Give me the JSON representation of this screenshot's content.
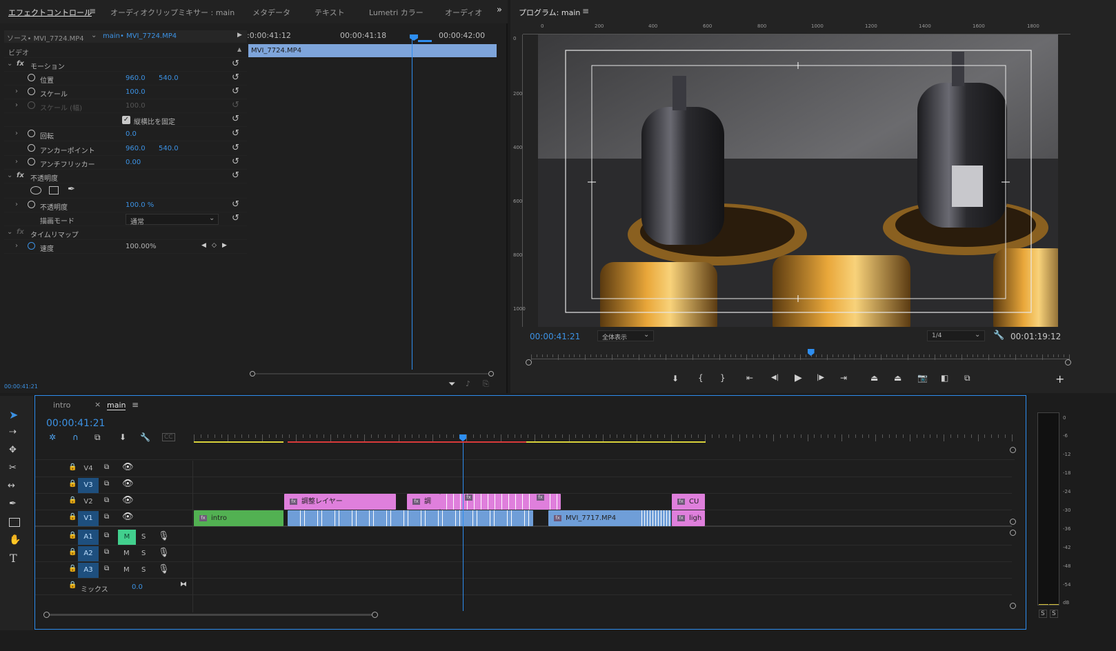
{
  "effect_controls_tabs": [
    "エフェクトコントロール",
    "オーディオクリップミキサー : main",
    "メタデータ",
    "テキスト",
    "Lumetri カラー",
    "オーディオ"
  ],
  "ec": {
    "source_label": "ソース• MVI_7724.MP4",
    "sequence_label": "main• MVI_7724.MP4",
    "timecodes": [
      ":0:00:41:12",
      "00:00:41:18",
      "00:00:42:00"
    ],
    "clip_name": "MVI_7724.MP4",
    "section_video": "ビデオ",
    "motion": "モーション",
    "position_label": "位置",
    "position_x": "960.0",
    "position_y": "540.0",
    "scale_label": "スケール",
    "scale_value": "100.0",
    "scale_width_label": "スケール (幅)",
    "scale_width_value": "100.0",
    "uniform_scale": "縦横比を固定",
    "rotation_label": "回転",
    "rotation_value": "0.0",
    "anchor_label": "アンカーポイント",
    "anchor_x": "960.0",
    "anchor_y": "540.0",
    "antiflicker_label": "アンチフリッカー",
    "antiflicker_value": "0.00",
    "opacity_section": "不透明度",
    "opacity_label": "不透明度",
    "opacity_value": "100.0 %",
    "blend_label": "描画モード",
    "blend_value": "通常",
    "timeremap_section": "タイムリマップ",
    "speed_label": "速度",
    "speed_value": "100.00%",
    "current_time": "00:00:41:21"
  },
  "program": {
    "title": "プログラム: main",
    "ruler": [
      "0",
      "200",
      "400",
      "600",
      "800",
      "1000",
      "1200",
      "1400",
      "1600",
      "1800"
    ],
    "vruler": [
      "0",
      "200",
      "400",
      "600",
      "800",
      "1000"
    ],
    "timecode": "00:00:41:21",
    "zoom": "全体表示",
    "resolution": "1/4",
    "duration": "00:01:19:12",
    "playhead_fraction": 0.52
  },
  "timeline": {
    "tabs": [
      "intro",
      "main"
    ],
    "timecode": "00:00:41:21",
    "video_tracks": [
      "V4",
      "V3",
      "V2",
      "V1"
    ],
    "audio_tracks": [
      "A1",
      "A2",
      "A3"
    ],
    "mix_label": "ミックス",
    "mix_value": "0.0",
    "clips": {
      "adjust": "調整レイヤー",
      "adjust_short": "調",
      "intro": "intro",
      "mvi7717": "MVI_7717.MP4",
      "cu": "CU",
      "ligh": "ligh"
    },
    "mute": "M",
    "solo": "S"
  },
  "meter": {
    "scale": [
      "0",
      "-6",
      "-12",
      "-18",
      "-24",
      "-30",
      "-36",
      "-42",
      "-48",
      "-54",
      "dB"
    ],
    "solo_left": "S",
    "solo_right": "S"
  }
}
